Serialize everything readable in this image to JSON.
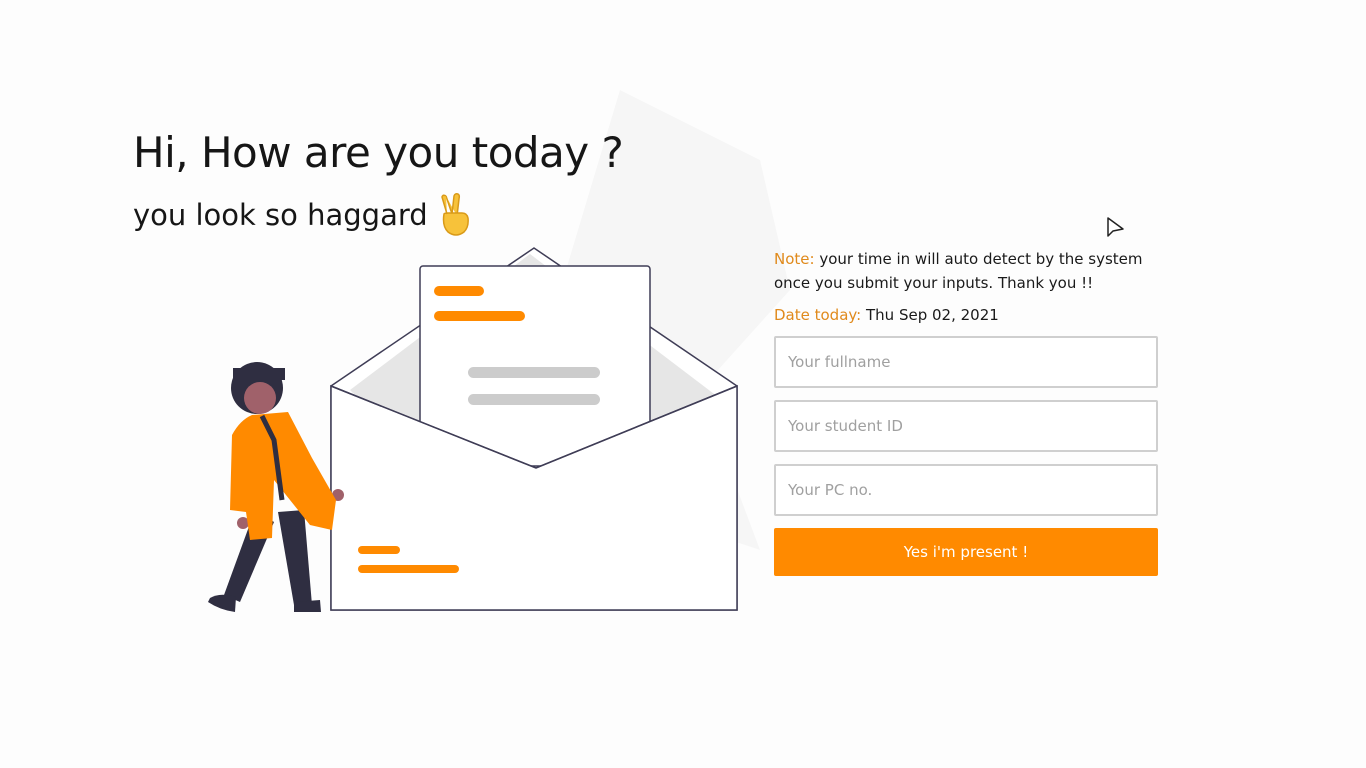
{
  "header": {
    "greeting": "Hi, How are you today ?",
    "sub_greeting": "you look so haggard"
  },
  "icons": {
    "hand": "victory-hand-icon",
    "cursor": "mouse-pointer-icon"
  },
  "form": {
    "note_label": "Note:",
    "note_text": " your time in will auto detect by the system once you submit your inputs. Thank you !!",
    "date_label": "Date today:",
    "date_value": " Thu Sep 02, 2021",
    "fullname_placeholder": "Your fullname",
    "student_id_placeholder": "Your student ID",
    "pc_no_placeholder": "Your PC no.",
    "submit_label": "Yes i'm present !"
  },
  "colors": {
    "accent": "#ff8a00",
    "accent_text": "#e08a1c",
    "border": "#cfcfcf",
    "figure_dark": "#2f2e41"
  }
}
